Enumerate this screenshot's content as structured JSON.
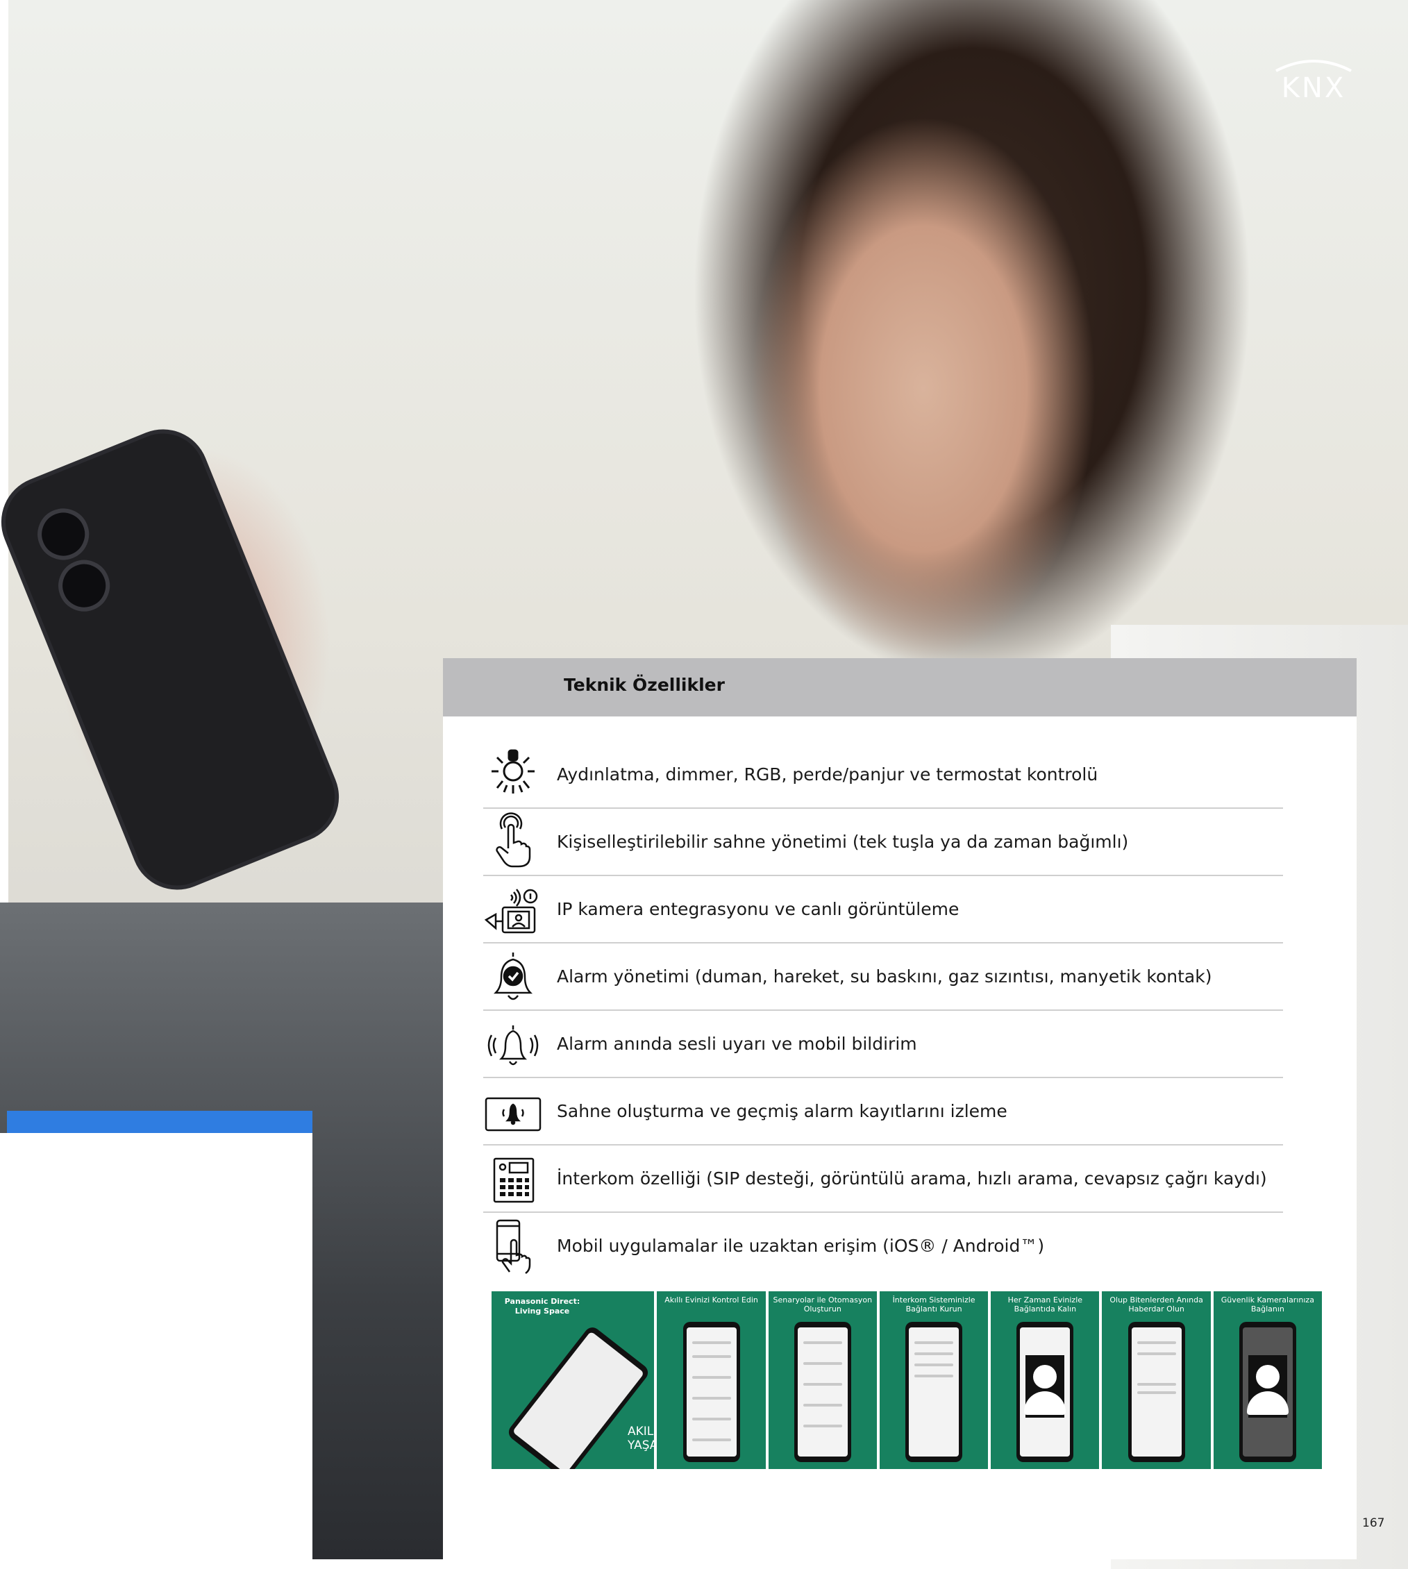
{
  "brand": {
    "logo_text": "KNX"
  },
  "panel": {
    "title": "Teknik Özellikler",
    "features": [
      {
        "icon": "light-bulb-icon",
        "text": "Aydınlatma, dimmer, RGB, perde/panjur ve termostat kontrolü"
      },
      {
        "icon": "touch-hand-icon",
        "text": "Kişiselleştirilebilir sahne yönetimi (tek tuşla ya da zaman bağımlı)"
      },
      {
        "icon": "ip-camera-icon",
        "text": "IP kamera entegrasyonu ve canlı görüntüleme"
      },
      {
        "icon": "alarm-bell-check-icon",
        "text": "Alarm yönetimi (duman, hareket, su baskını, gaz sızıntısı, manyetik kontak)"
      },
      {
        "icon": "ringing-bell-icon",
        "text": "Alarm anında sesli uyarı ve mobil bildirim"
      },
      {
        "icon": "alarm-panel-icon",
        "text": "Sahne oluşturma ve geçmiş alarm kayıtlarını izleme"
      },
      {
        "icon": "intercom-keypad-icon",
        "text": "İnterkom özelliği (SIP desteği, görüntülü arama, hızlı arama, cevapsız çağrı kaydı)"
      },
      {
        "icon": "mobile-touch-icon",
        "text": "Mobil uygulamalar ile uzaktan erişim (iOS® / Android™)"
      }
    ]
  },
  "app_strip": {
    "main_title": "Panasonic Direct: Living Space",
    "main_subtitle": "AKILLI YAŞAM",
    "tiles": [
      "Akıllı Evinizi Kontrol Edin",
      "Senaryolar ile Otomasyon Oluşturun",
      "İnterkom Sisteminizle Bağlantı Kurun",
      "Her Zaman Evinizle Bağlantıda Kalın",
      "Olup Bitenlerden Anında Haberdar Olun",
      "Güvenlik Kameralarınıza Bağlanın"
    ]
  },
  "page_number": "167",
  "colors": {
    "accent_blue": "#2f7de1",
    "panel_header": "#bcbcbe",
    "app_green": "#17815f"
  }
}
